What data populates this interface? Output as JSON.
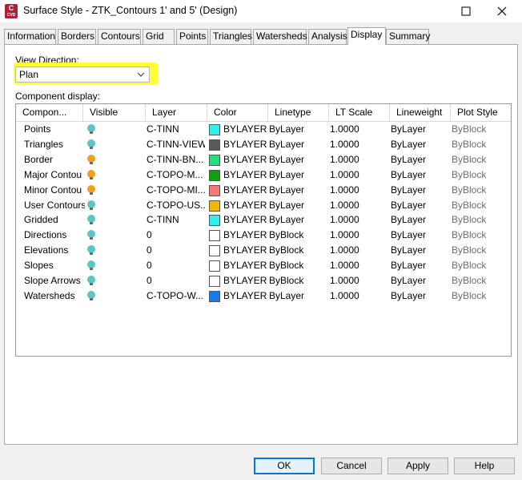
{
  "window": {
    "title": "Surface Style - ZTK_Contours 1' and 5' (Design)",
    "app_icon": "C",
    "app_icon_sub": "CVD"
  },
  "tabs": [
    {
      "label": "Information"
    },
    {
      "label": "Borders"
    },
    {
      "label": "Contours"
    },
    {
      "label": "Grid"
    },
    {
      "label": "Points"
    },
    {
      "label": "Triangles"
    },
    {
      "label": "Watersheds"
    },
    {
      "label": "Analysis"
    },
    {
      "label": "Display",
      "active": true
    },
    {
      "label": "Summary"
    }
  ],
  "view_direction": {
    "label": "View Direction:",
    "value": "Plan",
    "highlight_color": "#ffff33"
  },
  "component_display": {
    "label": "Component display:",
    "columns": [
      "Compon...",
      "Visible",
      "Layer",
      "Color",
      "Linetype",
      "LT Scale",
      "Lineweight",
      "Plot Style"
    ],
    "rows": [
      {
        "component": "Points",
        "visible": "on",
        "layer": "C-TINN",
        "color": "#33f0f0",
        "color_name": "BYLAYER",
        "linetype": "ByLayer",
        "lt_scale": "1.0000",
        "lineweight": "ByLayer",
        "plot_style": "ByBlock"
      },
      {
        "component": "Triangles",
        "visible": "on",
        "layer": "C-TINN-VIEW",
        "color": "#595959",
        "color_name": "BYLAYER",
        "linetype": "ByLayer",
        "lt_scale": "1.0000",
        "lineweight": "ByLayer",
        "plot_style": "ByBlock"
      },
      {
        "component": "Border",
        "visible": "off",
        "layer": "C-TINN-BN...",
        "color": "#22e07a",
        "color_name": "BYLAYER",
        "linetype": "ByLayer",
        "lt_scale": "1.0000",
        "lineweight": "ByLayer",
        "plot_style": "ByBlock"
      },
      {
        "component": "Major Contou",
        "visible": "off",
        "layer": "C-TOPO-M...",
        "color": "#0aa30a",
        "color_name": "BYLAYER",
        "linetype": "ByLayer",
        "lt_scale": "1.0000",
        "lineweight": "ByLayer",
        "plot_style": "ByBlock"
      },
      {
        "component": "Minor Contou",
        "visible": "off",
        "layer": "C-TOPO-MI...",
        "color": "#f47a7a",
        "color_name": "BYLAYER",
        "linetype": "ByLayer",
        "lt_scale": "1.0000",
        "lineweight": "ByLayer",
        "plot_style": "ByBlock"
      },
      {
        "component": "User Contours",
        "visible": "on",
        "layer": "C-TOPO-US...",
        "color": "#f2b600",
        "color_name": "BYLAYER",
        "linetype": "ByLayer",
        "lt_scale": "1.0000",
        "lineweight": "ByLayer",
        "plot_style": "ByBlock"
      },
      {
        "component": "Gridded",
        "visible": "on",
        "layer": "C-TINN",
        "color": "#33f0f0",
        "color_name": "BYLAYER",
        "linetype": "ByLayer",
        "lt_scale": "1.0000",
        "lineweight": "ByLayer",
        "plot_style": "ByBlock"
      },
      {
        "component": "Directions",
        "visible": "on",
        "layer": "0",
        "color": "#ffffff",
        "color_name": "BYLAYER",
        "linetype": "ByBlock",
        "lt_scale": "1.0000",
        "lineweight": "ByLayer",
        "plot_style": "ByBlock"
      },
      {
        "component": "Elevations",
        "visible": "on",
        "layer": "0",
        "color": "#ffffff",
        "color_name": "BYLAYER",
        "linetype": "ByBlock",
        "lt_scale": "1.0000",
        "lineweight": "ByLayer",
        "plot_style": "ByBlock"
      },
      {
        "component": "Slopes",
        "visible": "on",
        "layer": "0",
        "color": "#ffffff",
        "color_name": "BYLAYER",
        "linetype": "ByBlock",
        "lt_scale": "1.0000",
        "lineweight": "ByLayer",
        "plot_style": "ByBlock"
      },
      {
        "component": "Slope Arrows",
        "visible": "on",
        "layer": "0",
        "color": "#ffffff",
        "color_name": "BYLAYER",
        "linetype": "ByBlock",
        "lt_scale": "1.0000",
        "lineweight": "ByLayer",
        "plot_style": "ByBlock"
      },
      {
        "component": "Watersheds",
        "visible": "on",
        "layer": "C-TOPO-W...",
        "color": "#1a7ae8",
        "color_name": "BYLAYER",
        "linetype": "ByLayer",
        "lt_scale": "1.0000",
        "lineweight": "ByLayer",
        "plot_style": "ByBlock"
      }
    ]
  },
  "bulb_colors": {
    "on": "#5cc6c6",
    "off": "#f0a020"
  },
  "buttons": {
    "ok": "OK",
    "cancel": "Cancel",
    "apply": "Apply",
    "help": "Help"
  }
}
